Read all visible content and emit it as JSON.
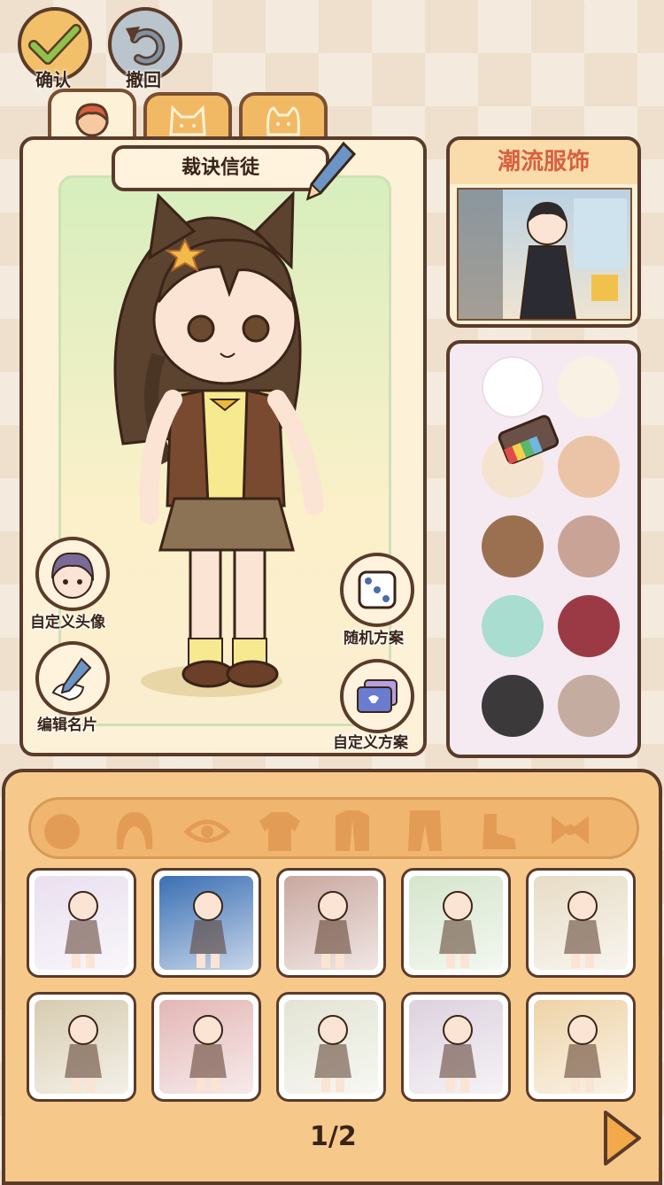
{
  "header": {
    "confirm_label": "确认",
    "undo_label": "撤回"
  },
  "tabs": [
    {
      "icon": "face-icon",
      "active": true
    },
    {
      "icon": "cat-face-icon"
    },
    {
      "icon": "dog-face-icon"
    }
  ],
  "character": {
    "name": "裁诀信徒"
  },
  "side_buttons": {
    "custom_avatar": "自定义头像",
    "edit_card": "编辑名片",
    "random_scheme": "随机方案",
    "custom_scheme": "自定义方案"
  },
  "outfit_card": {
    "title": "潮流服饰"
  },
  "palette": {
    "colors": [
      "#ffffff",
      "#f8f1e4",
      "#f4e4cf",
      "#ebc4a8",
      "#9b7050",
      "#c9a496",
      "#a8ddcf",
      "#9b3a45",
      "#3c393b",
      "#c4ada0"
    ],
    "selected_index": 2,
    "color_picker_icon": "color-card-icon"
  },
  "categories": [
    "head-shape-icon",
    "hair-icon",
    "eye-icon",
    "shirt-icon",
    "coat-icon",
    "pants-icon",
    "shoe-icon",
    "bow-icon"
  ],
  "outfits": {
    "row1": [
      "#e9e0ef",
      "#3a6fb3",
      "#caa8a0",
      "#d5e5cc",
      "#e7dcc5"
    ],
    "row2": [
      "#d7ccb0",
      "#e3b7b6",
      "#e3e4d4",
      "#ddd2df",
      "#eed3a7"
    ]
  },
  "pager": {
    "text": "1/2"
  }
}
